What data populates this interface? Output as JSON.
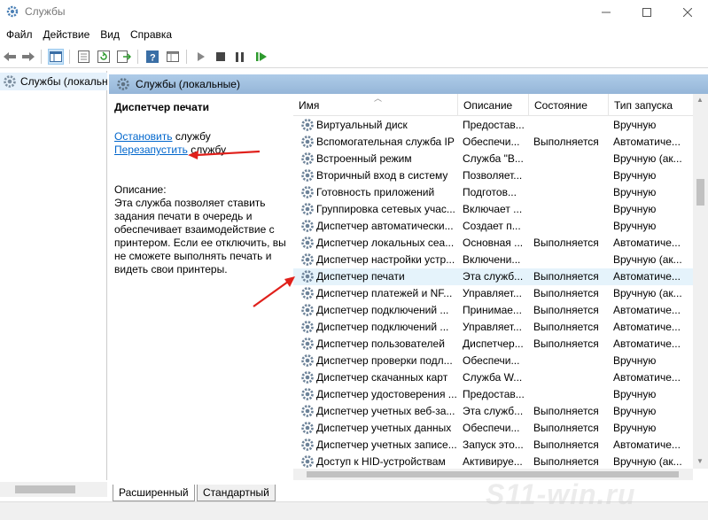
{
  "window": {
    "title": "Службы"
  },
  "menu": [
    "Файл",
    "Действие",
    "Вид",
    "Справка"
  ],
  "tree": {
    "item": "Службы (локальные)"
  },
  "panel": {
    "header": "Службы (локальные)"
  },
  "description": {
    "service_name": "Диспетчер печати",
    "stop_link": "Остановить",
    "stop_suffix": " службу",
    "restart_link": "Перезапустить",
    "restart_suffix": " службу",
    "label": "Описание:",
    "text": "Эта служба позволяет ставить задания печати в очередь и обеспечивает взаимодействие с принтером. Если ее отключить, вы не сможете выполнять печать и видеть свои принтеры."
  },
  "columns": {
    "name": "Имя",
    "description": "Описание",
    "state": "Состояние",
    "startup": "Тип запуска"
  },
  "rows": [
    {
      "name": "Виртуальный диск",
      "desc": "Предостав...",
      "state": "",
      "startup": "Вручную"
    },
    {
      "name": "Вспомогательная служба IP",
      "desc": "Обеспечи...",
      "state": "Выполняется",
      "startup": "Автоматиче..."
    },
    {
      "name": "Встроенный режим",
      "desc": "Служба \"В...",
      "state": "",
      "startup": "Вручную (ак..."
    },
    {
      "name": "Вторичный вход в систему",
      "desc": "Позволяет...",
      "state": "",
      "startup": "Вручную"
    },
    {
      "name": "Готовность приложений",
      "desc": "Подготов...",
      "state": "",
      "startup": "Вручную"
    },
    {
      "name": "Группировка сетевых учас...",
      "desc": "Включает ...",
      "state": "",
      "startup": "Вручную"
    },
    {
      "name": "Диспетчер автоматически...",
      "desc": "Создает п...",
      "state": "",
      "startup": "Вручную"
    },
    {
      "name": "Диспетчер локальных сеа...",
      "desc": "Основная ...",
      "state": "Выполняется",
      "startup": "Автоматиче..."
    },
    {
      "name": "Диспетчер настройки устр...",
      "desc": "Включени...",
      "state": "",
      "startup": "Вручную (ак..."
    },
    {
      "name": "Диспетчер печати",
      "desc": "Эта служб...",
      "state": "Выполняется",
      "startup": "Автоматиче..."
    },
    {
      "name": "Диспетчер платежей и NF...",
      "desc": "Управляет...",
      "state": "Выполняется",
      "startup": "Вручную (ак..."
    },
    {
      "name": "Диспетчер подключений ...",
      "desc": "Принимае...",
      "state": "Выполняется",
      "startup": "Автоматиче..."
    },
    {
      "name": "Диспетчер подключений ...",
      "desc": "Управляет...",
      "state": "Выполняется",
      "startup": "Автоматиче..."
    },
    {
      "name": "Диспетчер пользователей",
      "desc": "Диспетчер...",
      "state": "Выполняется",
      "startup": "Автоматиче..."
    },
    {
      "name": "Диспетчер проверки подл...",
      "desc": "Обеспечи...",
      "state": "",
      "startup": "Вручную"
    },
    {
      "name": "Диспетчер скачанных карт",
      "desc": "Служба W...",
      "state": "",
      "startup": "Автоматиче..."
    },
    {
      "name": "Диспетчер удостоверения ...",
      "desc": "Предостав...",
      "state": "",
      "startup": "Вручную"
    },
    {
      "name": "Диспетчер учетных веб-за...",
      "desc": "Эта служб...",
      "state": "Выполняется",
      "startup": "Вручную"
    },
    {
      "name": "Диспетчер учетных данных",
      "desc": "Обеспечи...",
      "state": "Выполняется",
      "startup": "Вручную"
    },
    {
      "name": "Диспетчер учетных записе...",
      "desc": "Запуск это...",
      "state": "Выполняется",
      "startup": "Автоматиче..."
    },
    {
      "name": "Доступ к HID-устройствам",
      "desc": "Активируе...",
      "state": "Выполняется",
      "startup": "Вручную (ак..."
    }
  ],
  "tabs": {
    "extended": "Расширенный",
    "standard": "Стандартный"
  },
  "watermark": "Ѕ11-wіn.ru",
  "colors": {
    "accent": "#0066cc",
    "selected": "#e5f3fb",
    "annotation": "#e0201b"
  }
}
